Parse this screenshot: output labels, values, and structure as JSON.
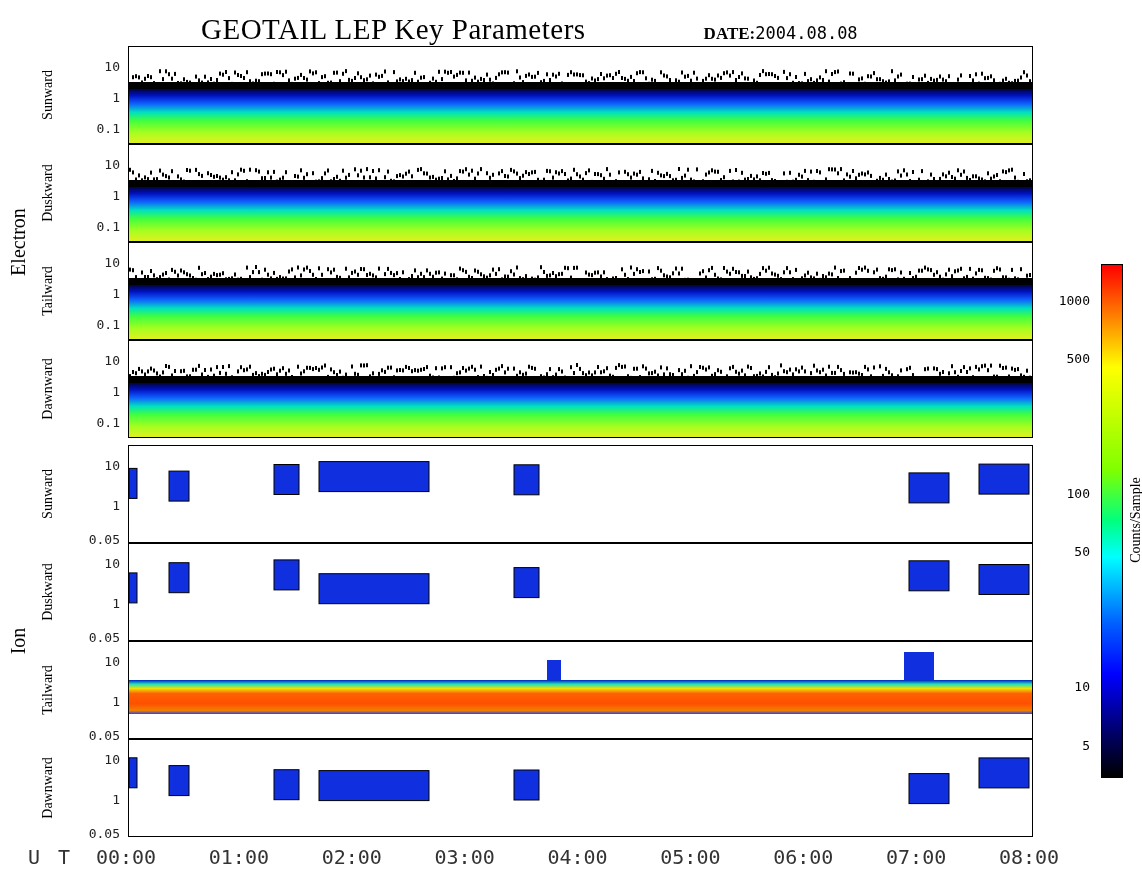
{
  "title": "GEOTAIL LEP Key Parameters",
  "date": {
    "label": "DATE:",
    "value": "2004.08.08"
  },
  "groups": [
    {
      "name": "Electron",
      "kind": "electron",
      "panels": [
        {
          "label": "Sunward",
          "kind": "electron",
          "ticks": [
            "10",
            "1",
            "0.1"
          ]
        },
        {
          "label": "Duskward",
          "kind": "electron",
          "ticks": [
            "10",
            "1",
            "0.1"
          ]
        },
        {
          "label": "Tailward",
          "kind": "electron",
          "ticks": [
            "10",
            "1",
            "0.1"
          ]
        },
        {
          "label": "Dawnward",
          "kind": "electron",
          "ticks": [
            "10",
            "1",
            "0.1"
          ]
        }
      ]
    },
    {
      "name": "Ion",
      "kind": "ion",
      "panels": [
        {
          "label": "Sunward",
          "kind": "ion-sparse",
          "ticks": [
            "10",
            "1",
            "0.05"
          ]
        },
        {
          "label": "Duskward",
          "kind": "ion-sparse",
          "ticks": [
            "10",
            "1",
            "0.05"
          ]
        },
        {
          "label": "Tailward",
          "kind": "ion-band",
          "ticks": [
            "10",
            "1",
            "0.05"
          ]
        },
        {
          "label": "Dawnward",
          "kind": "ion-sparse",
          "ticks": [
            "10",
            "1",
            "0.05"
          ]
        }
      ]
    }
  ],
  "x_axis": {
    "label": "U T",
    "ticks": [
      "00:00",
      "01:00",
      "02:00",
      "03:00",
      "04:00",
      "05:00",
      "06:00",
      "07:00",
      "08:00"
    ]
  },
  "colorbar": {
    "title": "Counts/Sample",
    "ticks": [
      "1000",
      "500",
      "100",
      "50",
      "10",
      "5"
    ]
  }
}
